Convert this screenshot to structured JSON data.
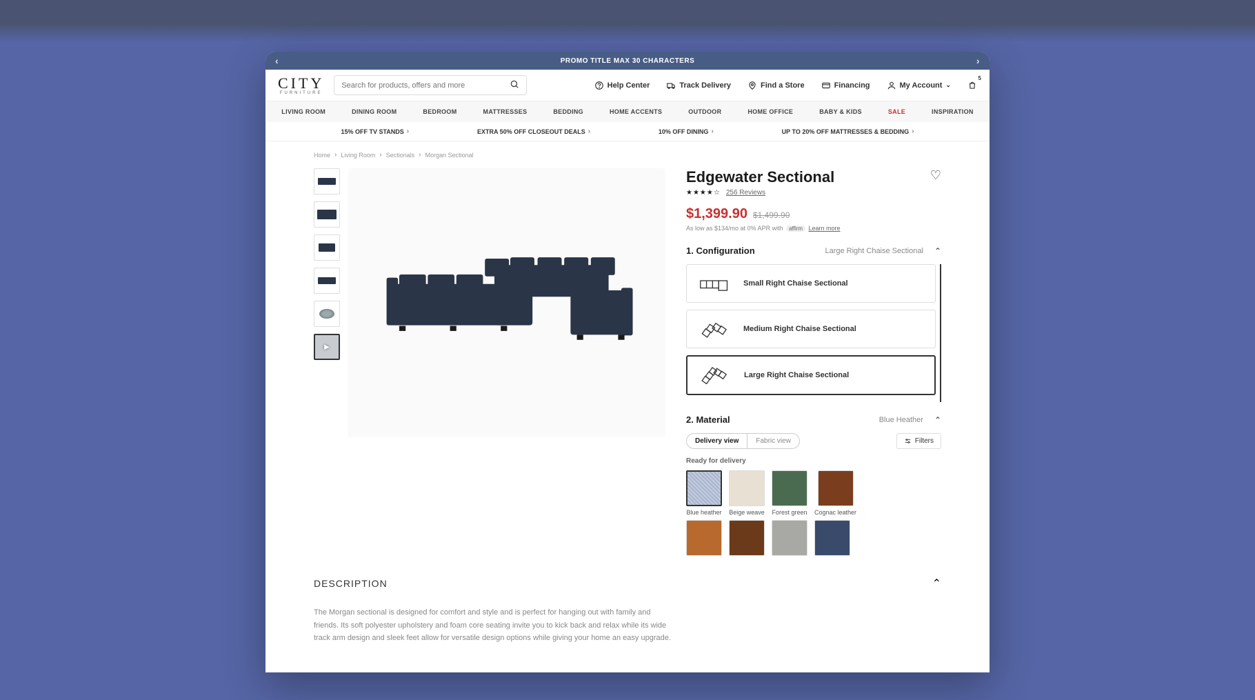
{
  "promo_banner": "PROMO TITLE MAX 30 CHARACTERS",
  "logo": "CITY",
  "logo_sub": "FURNITURE",
  "search_placeholder": "Search for products, offers and more",
  "header_links": {
    "help": "Help Center",
    "track": "Track Delivery",
    "store": "Find a Store",
    "financing": "Financing",
    "account": "My Account"
  },
  "cart_count": "5",
  "nav": [
    "LIVING ROOM",
    "DINING ROOM",
    "BEDROOM",
    "MATTRESSES",
    "BEDDING",
    "HOME ACCENTS",
    "OUTDOOR",
    "HOME OFFICE",
    "BABY & KIDS",
    "SALE",
    "INSPIRATION"
  ],
  "promos": [
    "15% OFF TV STANDS",
    "EXTRA 50% OFF CLOSEOUT DEALS",
    "10% OFF DINING",
    "UP TO 20% OFF MATTRESSES & BEDDING"
  ],
  "breadcrumb": [
    "Home",
    "Living Room",
    "Sectionals",
    "Morgan Sectional"
  ],
  "product": {
    "title": "Edgewater Sectional",
    "reviews": "256 Reviews",
    "price": "$1,399.90",
    "price_old": "$1,499.90",
    "affirm_prefix": "As low as $134/mo at 0% APR with",
    "affirm_brand": "affirm",
    "affirm_link": "Learn more"
  },
  "config": {
    "title": "1. Configuration",
    "value": "Large Right Chaise Sectional",
    "options": [
      "Small Right Chaise Sectional",
      "Medium Right Chaise Sectional",
      "Large Right Chaise Sectional"
    ]
  },
  "material": {
    "title": "2. Material",
    "value": "Blue Heather",
    "view_delivery": "Delivery view",
    "view_fabric": "Fabric view",
    "filters": "Filters",
    "ready": "Ready for delivery",
    "swatches_row1": [
      "Blue heather",
      "Beige weave",
      "Forest green",
      "Cognac leather"
    ],
    "swatch_classes_row1": [
      "sw-blue",
      "sw-beige",
      "sw-forest",
      "sw-cognac"
    ],
    "swatch_classes_row2": [
      "sw-tan",
      "sw-brown",
      "sw-grey",
      "sw-navy"
    ]
  },
  "description": {
    "title": "DESCRIPTION",
    "body": "The Morgan sectional is designed for comfort and style and is perfect for hanging out with family and friends. Its soft polyester upholstery and foam core seating invite you to kick back and relax while its wide track arm design and sleek feet allow for versatile design options while giving your home an easy upgrade."
  }
}
